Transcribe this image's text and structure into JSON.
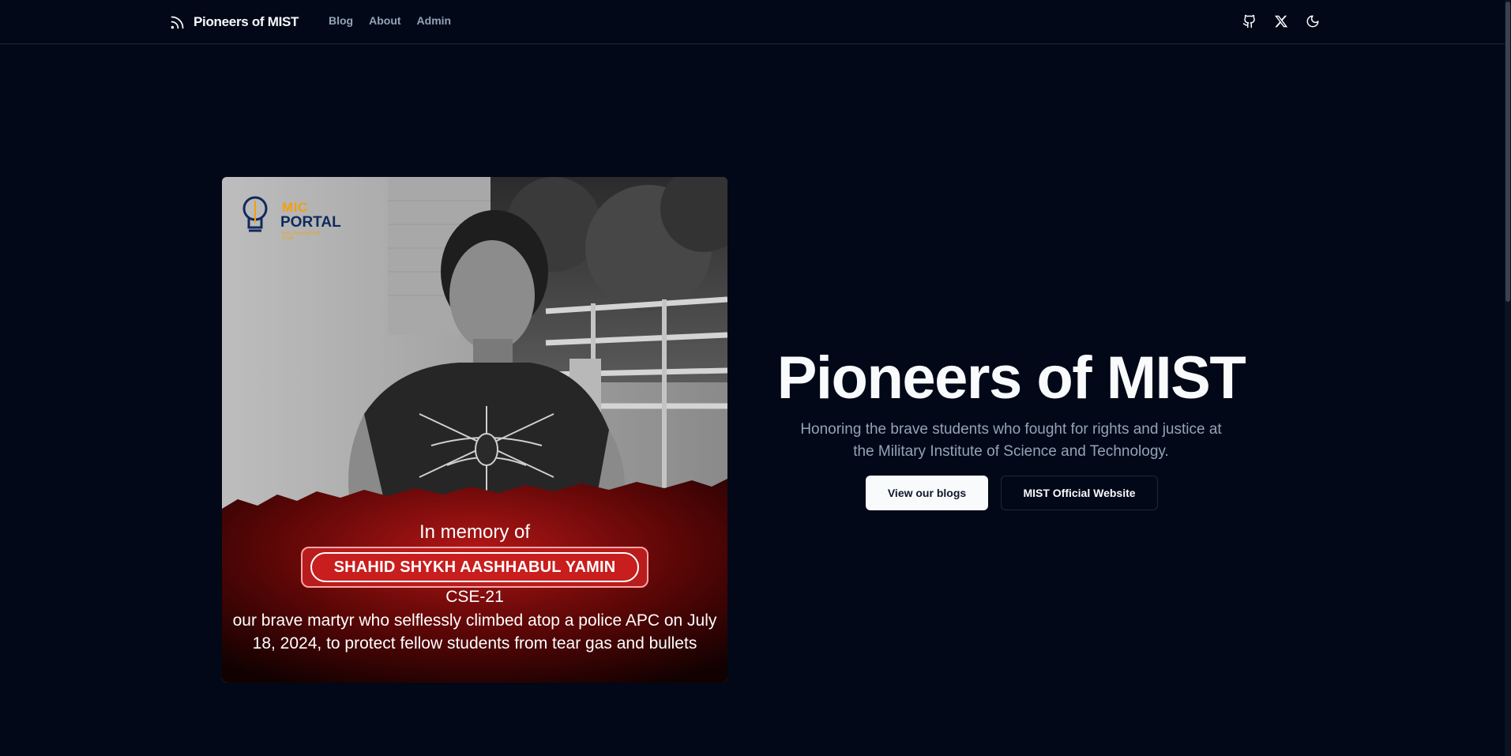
{
  "header": {
    "brand": "Pioneers of MIST",
    "nav": [
      {
        "label": "Blog"
      },
      {
        "label": "About"
      },
      {
        "label": "Admin"
      }
    ],
    "actions": [
      {
        "icon": "github-icon"
      },
      {
        "icon": "x-twitter-icon"
      },
      {
        "icon": "moon-icon"
      }
    ]
  },
  "memorial": {
    "logo": {
      "line1": "MIC",
      "line2": "PORTAL",
      "line3": "MIST INNOVATION CLUB"
    },
    "in_memory": "In memory of",
    "name": "SHAHID SHYKH AASHHABUL YAMIN",
    "batch": "CSE-21",
    "tribute": "our brave martyr who selflessly climbed atop a police APC on July 18, 2024, to protect fellow students from tear gas and bullets"
  },
  "hero": {
    "title": "Pioneers of MIST",
    "subtitle": "Honoring the brave students who fought for rights and justice at the Military Institute of Science and Technology.",
    "primary_button": "View our blogs",
    "secondary_button": "MIST Official Website"
  },
  "colors": {
    "background": "#020817",
    "foreground": "#f8fafc",
    "muted": "#94a3b8",
    "border": "#1e293b",
    "memorial_red": "#c81e1e"
  }
}
